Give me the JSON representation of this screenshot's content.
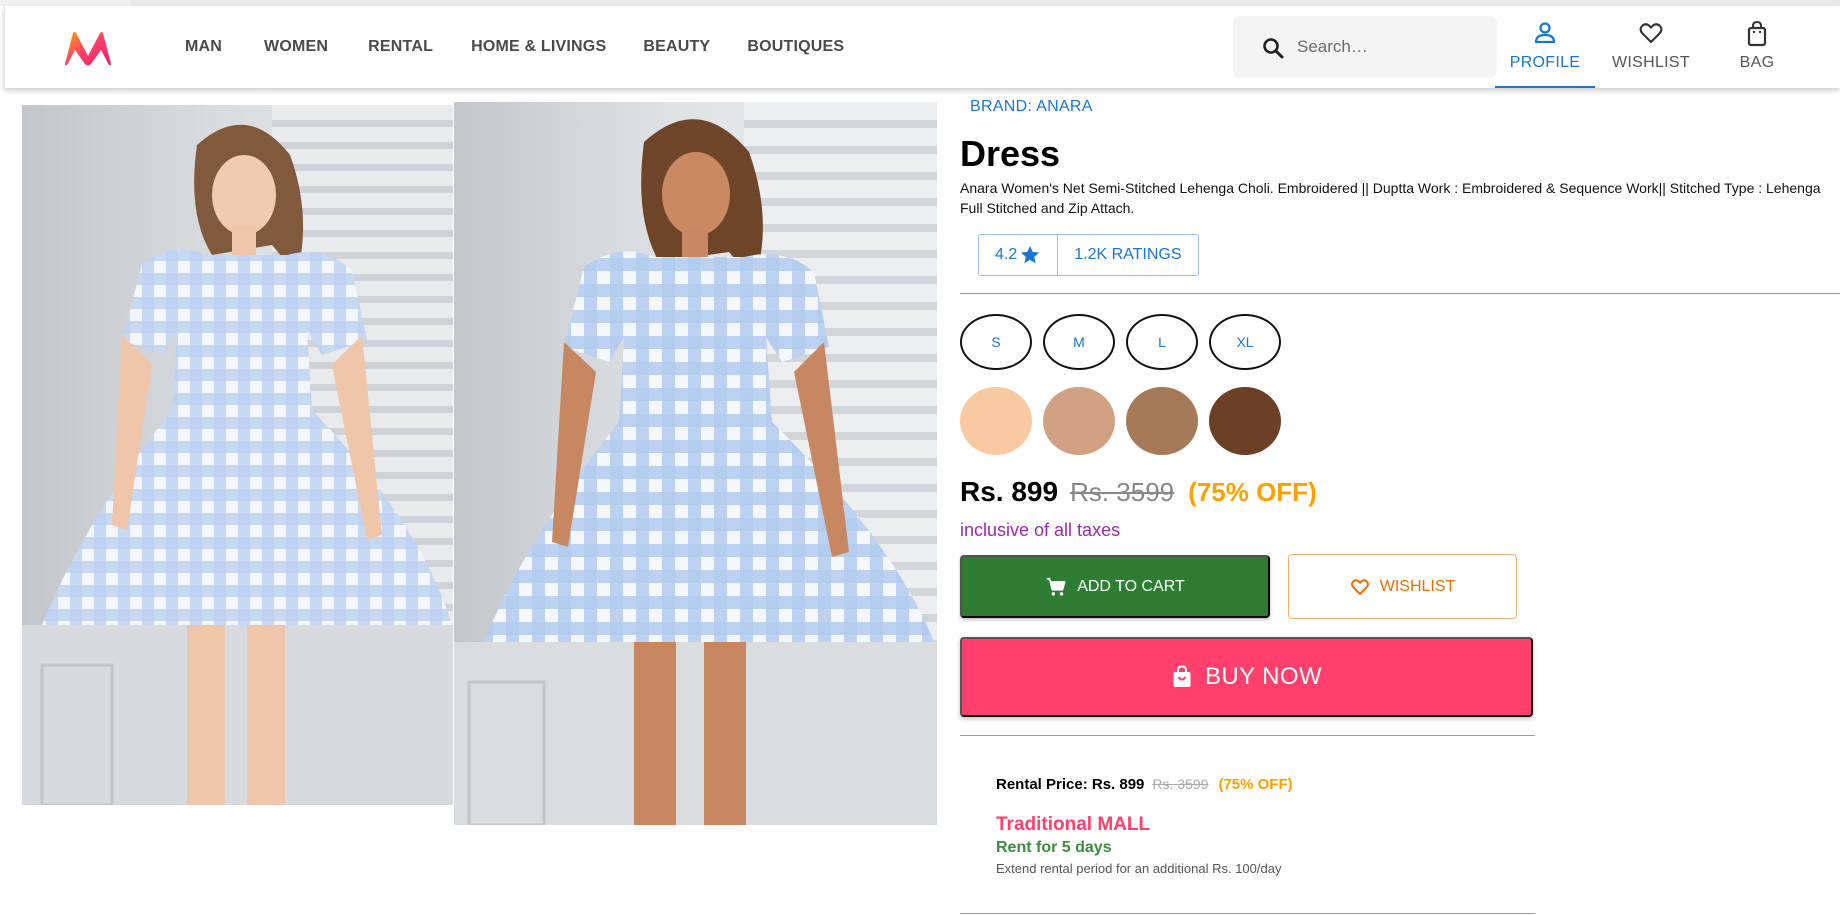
{
  "header": {
    "logo_icon": "myntra-logo-icon",
    "nav": [
      "MAN",
      "WOMEN",
      "RENTAL",
      "HOME & LIVINGS",
      "BEAUTY",
      "BOUTIQUES"
    ],
    "search": {
      "placeholder": "Search…",
      "icon": "search-icon"
    },
    "actions": [
      {
        "label": "PROFILE",
        "icon": "person-icon",
        "active": true
      },
      {
        "label": "WISHLIST",
        "icon": "heart-icon",
        "active": false
      },
      {
        "label": "BAG",
        "icon": "bag-icon",
        "active": false
      }
    ],
    "accent": "#1976d2"
  },
  "product": {
    "brand": "BRAND: ANARA",
    "title": "Dress",
    "description_line1": "Anara Women's Net Semi-Stitched Lehenga Choli. Embroidered || Duptta Work : Embroidered & Sequence Work|| Stitched Type : Lehenga",
    "description_line2": "Full Stitched and Zip Attach.",
    "rating": {
      "value": "4.2",
      "icon": "star-icon",
      "count": "1.2K RATINGS"
    },
    "sizes": [
      "S",
      "M",
      "L",
      "XL"
    ],
    "colors": [
      "#f9c9a1",
      "#d2a183",
      "#a67958",
      "#6d3f26"
    ],
    "price": "Rs. 899",
    "mrp": "Rs. 3599",
    "discount": "(75% OFF)",
    "taxes": "inclusive of all taxes",
    "add_to_cart": "ADD TO CART",
    "wishlist": "WISHLIST",
    "buy_now": "BUY NOW",
    "images": [
      "product-image-front",
      "product-image-side"
    ]
  },
  "rental": {
    "label": "Rental Price: Rs. 899",
    "mrp": "Rs. 3599",
    "discount": "(75% OFF)",
    "mall": "Traditional MALL",
    "days": "Rent for 5 days",
    "extend": "Extend rental period for an additional Rs. 100/day"
  }
}
